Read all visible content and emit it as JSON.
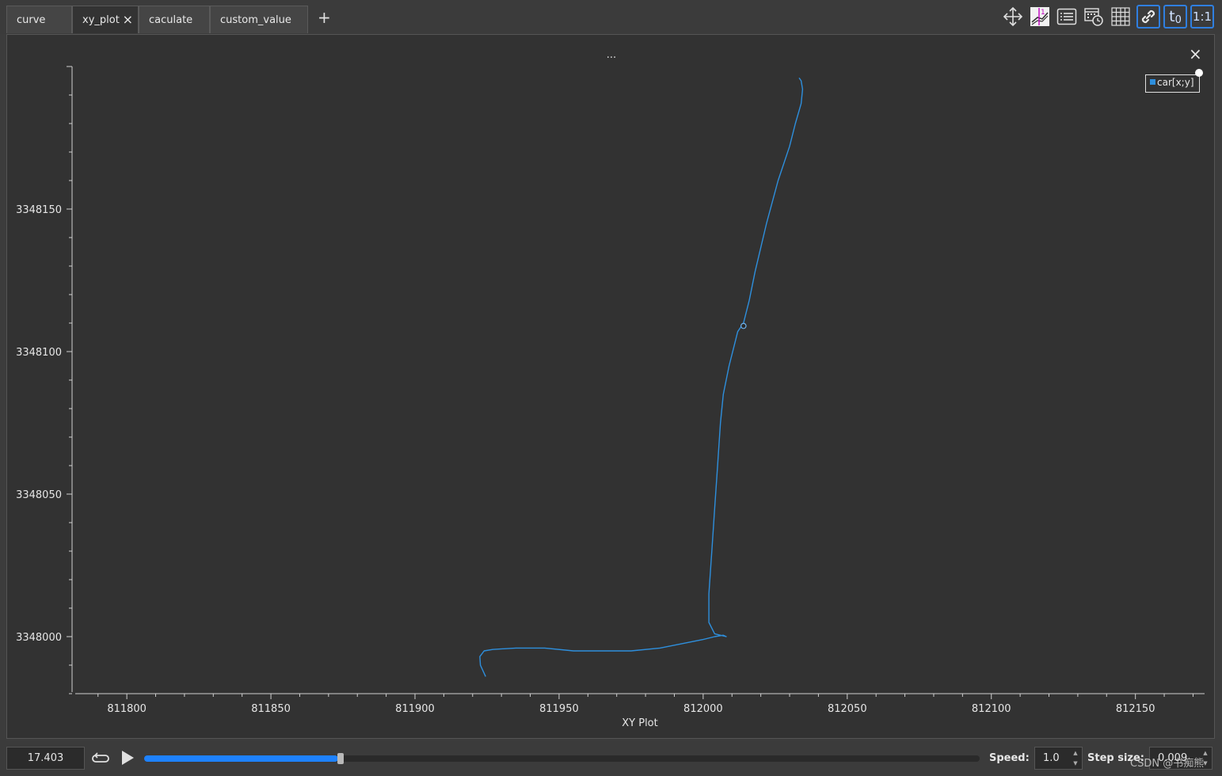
{
  "tabs": [
    {
      "label": "curve"
    },
    {
      "label": "xy_plot",
      "close": "×"
    },
    {
      "label": "caculate"
    },
    {
      "label": "custom_value"
    }
  ],
  "add_tab": "+",
  "toolbar": {
    "icons": [
      "move-icon",
      "zoom-reset-icon",
      "list-icon",
      "calendar-clock-icon",
      "grid-icon",
      "link-icon",
      "t-zero-icon",
      "ratio-1-1-icon"
    ],
    "t0_label": "t",
    "t0_sub": "0",
    "ratio_label": "1:1"
  },
  "plot": {
    "title": "...",
    "close": "×",
    "legend": "car[x;y]",
    "xlabel": "XY Plot"
  },
  "chart_data": {
    "type": "scatter",
    "xlabel": "XY Plot",
    "ylabel": "",
    "x_ticks": [
      "811800",
      "811850",
      "811900",
      "811950",
      "812000",
      "812050",
      "812100",
      "812150"
    ],
    "y_ticks": [
      "3348000",
      "3348050",
      "3348100",
      "3348150"
    ],
    "xlim": [
      811781,
      812174
    ],
    "ylim": [
      3347980,
      3348200
    ],
    "series": [
      {
        "name": "car[x;y]",
        "color": "#2e8fdd",
        "x": [
          811924.5,
          811922.7,
          811922.5,
          811924.0,
          811927,
          811935,
          811945,
          811955,
          811965,
          811975,
          811985,
          811995,
          812000,
          812004,
          812007,
          812008,
          812004,
          812002,
          812002,
          812003,
          812004,
          812005,
          812006,
          812007,
          812009,
          812011,
          812012,
          812014,
          812016,
          812018,
          812022,
          812026,
          812030,
          812032,
          812034,
          812034.5,
          812034,
          812033.3
        ],
        "y": [
          3347986,
          3347990,
          3347993,
          3347995,
          3347995.5,
          3347996,
          3347996,
          3347995,
          3347995,
          3347995,
          3347996,
          3347998,
          3347999,
          3348000,
          3348000.5,
          3348000,
          3348001,
          3348005,
          3348015,
          3348030,
          3348045,
          3348060,
          3348075,
          3348085,
          3348095,
          3348103,
          3348107,
          3348110,
          3348118,
          3348128,
          3348145,
          3348160,
          3348172,
          3348180,
          3348187,
          3348192,
          3348195,
          3348196
        ]
      }
    ],
    "cursor": {
      "x": 812014,
      "y": 3348109
    },
    "grid": false,
    "legend_position": "top-right"
  },
  "bottom": {
    "time": "17.403",
    "progress": 0.232,
    "speed_label": "Speed:",
    "speed_value": "1.0",
    "step_label": "Step size:",
    "step_value": "0.009",
    "watermark": "CSDN @书痴熊",
    "spin_up": "▲",
    "spin_down": "▼"
  },
  "colors": {
    "accent": "#1e82ff",
    "series": "#2e8fdd",
    "plot_bg": "#323232"
  }
}
